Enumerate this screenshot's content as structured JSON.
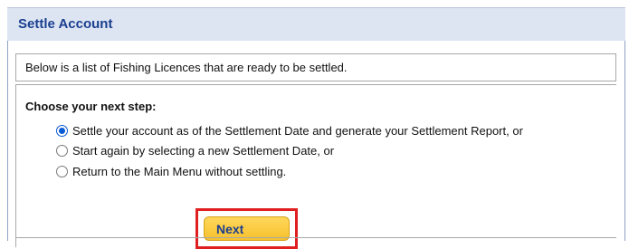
{
  "header": {
    "title": "Settle Account"
  },
  "intro": {
    "text": "Below is a list of Fishing Licences that are ready to be settled."
  },
  "steps": {
    "heading": "Choose your next step:",
    "options": [
      {
        "label": "Settle your account as of the Settlement Date and generate your Settlement Report, or",
        "selected": true
      },
      {
        "label": "Start again by selecting a new Settlement Date, or",
        "selected": false
      },
      {
        "label": "Return to the Main Menu without settling.",
        "selected": false
      }
    ]
  },
  "actions": {
    "next_label": "Next"
  },
  "colors": {
    "header_bg": "#dde5f3",
    "header_text": "#1b3f8f",
    "button_bg": "#f6c12d",
    "highlight": "#e02020",
    "radio_selected": "#0a5bd6"
  }
}
